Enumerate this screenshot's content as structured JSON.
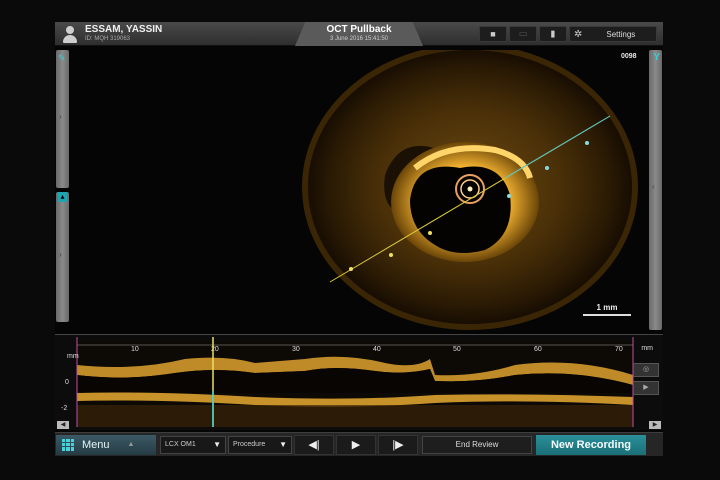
{
  "header": {
    "patient_name": "ESSAM, YASSIN",
    "patient_id": "ID: MQH 319063",
    "title": "OCT Pullback",
    "date": "3 June 2016 15:41:50",
    "tools": [
      {
        "icon": "camera-icon"
      },
      {
        "icon": "ruler-icon"
      },
      {
        "icon": "bookmark-icon"
      }
    ],
    "settings_label": "Settings",
    "settings_icon": "gear-icon"
  },
  "image": {
    "frame_number": "0098",
    "scale_label": "1 mm",
    "accent_color": "#37d0d6"
  },
  "longitudinal": {
    "unit_left": "mm",
    "unit_right": "mm",
    "ticks": [
      "10",
      "20",
      "30",
      "40",
      "50",
      "60",
      "70"
    ],
    "y_zero": "0",
    "y_neg": "-2",
    "cursor_position_mm": 20
  },
  "bottom_bar": {
    "menu_label": "Menu",
    "vessel_value": "LCX OM1",
    "procedure_value": "Procedure",
    "end_review_label": "End Review",
    "new_recording_label": "New Recording",
    "new_recording_color": "#2a8f98"
  }
}
